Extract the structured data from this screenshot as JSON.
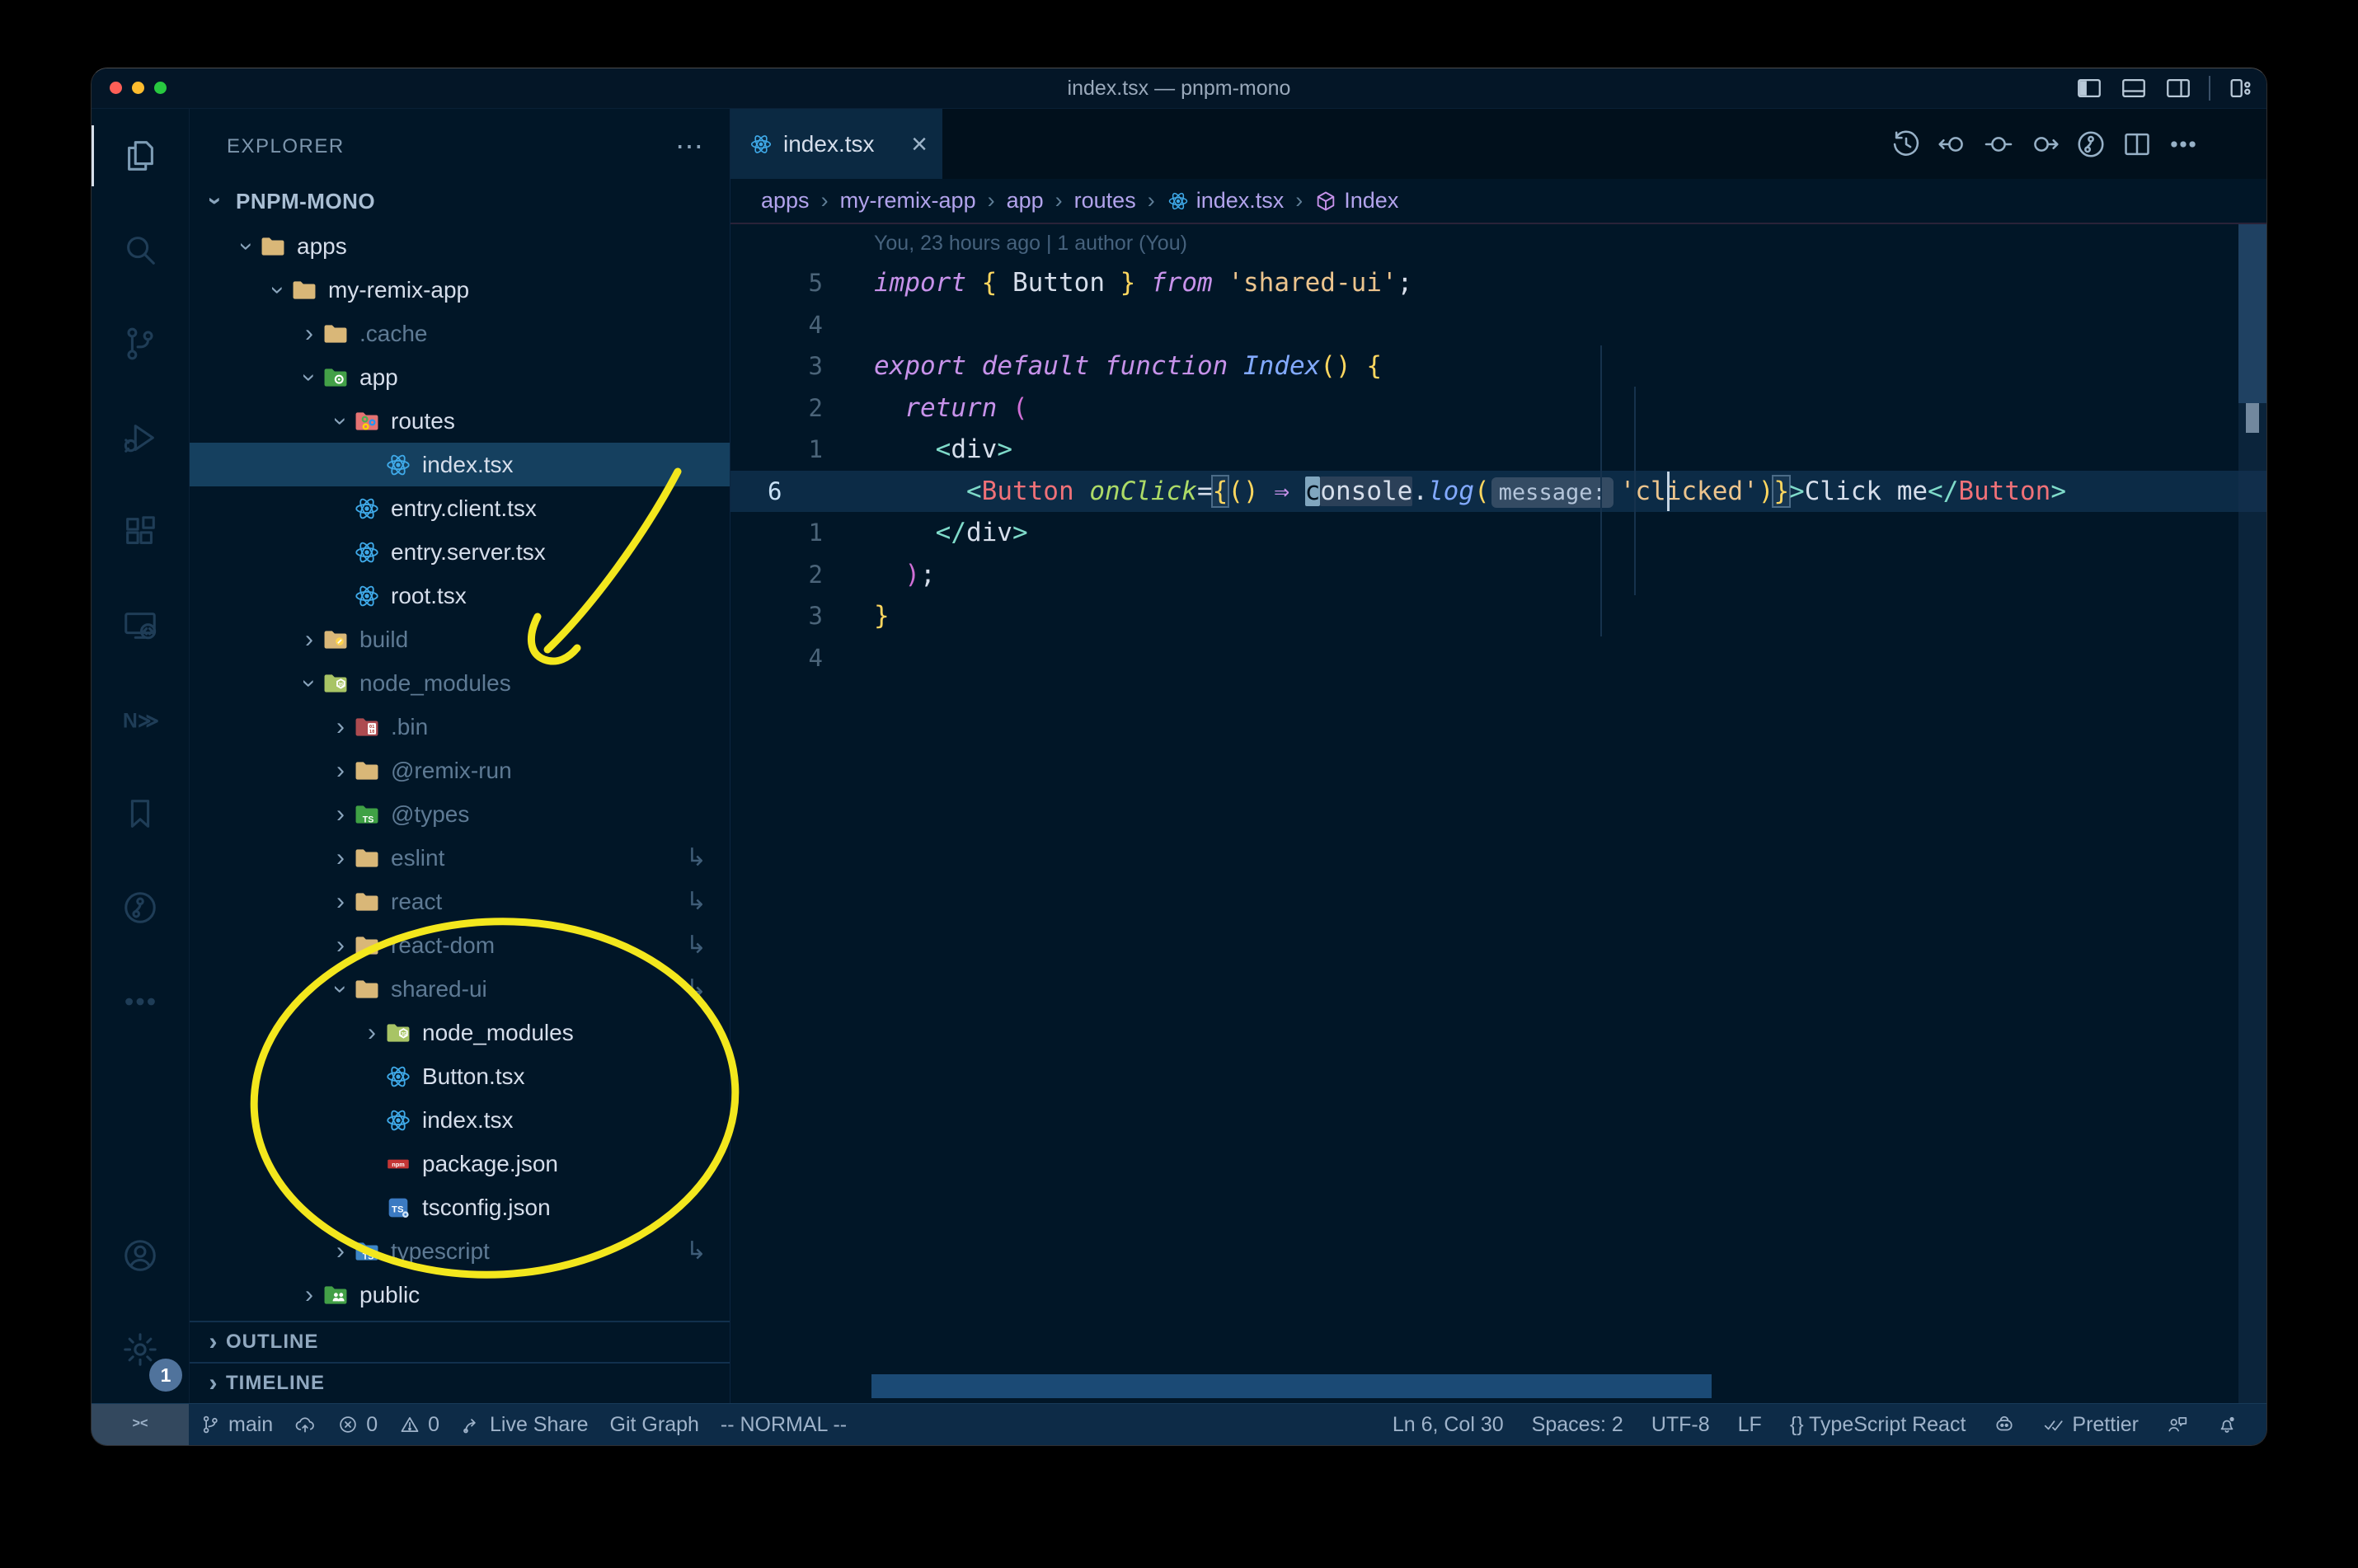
{
  "theme": {
    "background": "#011627",
    "annotation_yellow": "#f3e71d",
    "selection_blue": "#15405f",
    "status_bar": "#0d2b47",
    "active_tab": "#0b2942",
    "react_blue": "#3fa9e8",
    "folder_tan": "#d9b778",
    "traffic_red": "#ff5f57",
    "traffic_yellow": "#febc2e",
    "traffic_green": "#28c840"
  },
  "titlebar": {
    "title": "index.tsx — pnpm-mono",
    "layout_icons": [
      "layout-sidebar-left",
      "layout-panel",
      "layout-sidebar-right",
      "layout-customize"
    ]
  },
  "activity_bar": {
    "items": [
      {
        "name": "explorer",
        "icon": "files",
        "active": true
      },
      {
        "name": "search",
        "icon": "search"
      },
      {
        "name": "source-control",
        "icon": "source-control"
      },
      {
        "name": "run-debug",
        "icon": "debug"
      },
      {
        "name": "extensions",
        "icon": "extensions"
      },
      {
        "name": "remote-explorer",
        "icon": "remote"
      },
      {
        "name": "nx-console",
        "icon": "nx"
      },
      {
        "name": "bookmarks",
        "icon": "bookmark"
      },
      {
        "name": "gitlens",
        "icon": "gitlens"
      },
      {
        "name": "more-views",
        "icon": "more"
      }
    ],
    "bottom": [
      {
        "name": "accounts",
        "icon": "account"
      },
      {
        "name": "settings",
        "icon": "gear",
        "badge": "1"
      }
    ]
  },
  "explorer": {
    "header": "EXPLORER",
    "actions": "⋯",
    "root": "PNPM-MONO",
    "tree": [
      {
        "label": "apps",
        "icon": "folder",
        "level": 0,
        "state": "open"
      },
      {
        "label": "my-remix-app",
        "icon": "folder",
        "level": 1,
        "state": "open"
      },
      {
        "label": ".cache",
        "icon": "folder",
        "level": 2,
        "state": "closed",
        "dim": true
      },
      {
        "label": "app",
        "icon": "folder-app",
        "level": 2,
        "state": "open"
      },
      {
        "label": "routes",
        "icon": "folder-routes",
        "level": 3,
        "state": "open"
      },
      {
        "label": "index.tsx",
        "icon": "react",
        "level": 4,
        "selected": true
      },
      {
        "label": "entry.client.tsx",
        "icon": "react",
        "level": 3
      },
      {
        "label": "entry.server.tsx",
        "icon": "react",
        "level": 3
      },
      {
        "label": "root.tsx",
        "icon": "react",
        "level": 3
      },
      {
        "label": "build",
        "icon": "folder-build",
        "level": 2,
        "state": "closed",
        "dim": true
      },
      {
        "label": "node_modules",
        "icon": "folder-node",
        "level": 2,
        "state": "open",
        "dim": true
      },
      {
        "label": ".bin",
        "icon": "folder-bin",
        "level": 3,
        "state": "closed",
        "dim": true
      },
      {
        "label": "@remix-run",
        "icon": "folder",
        "level": 3,
        "state": "closed",
        "dim": true
      },
      {
        "label": "@types",
        "icon": "folder-types",
        "level": 3,
        "state": "closed",
        "dim": true
      },
      {
        "label": "eslint",
        "icon": "folder",
        "level": 3,
        "state": "closed",
        "dim": true,
        "symlink": true
      },
      {
        "label": "react",
        "icon": "folder",
        "level": 3,
        "state": "closed",
        "dim": true,
        "symlink": true
      },
      {
        "label": "react-dom",
        "icon": "folder",
        "level": 3,
        "state": "closed",
        "dim": true,
        "symlink": true
      },
      {
        "label": "shared-ui",
        "icon": "folder",
        "level": 3,
        "state": "open",
        "dim": true,
        "symlink": true
      },
      {
        "label": "node_modules",
        "icon": "folder-node",
        "level": 4,
        "state": "closed"
      },
      {
        "label": "Button.tsx",
        "icon": "react",
        "level": 4
      },
      {
        "label": "index.tsx",
        "icon": "react",
        "level": 4
      },
      {
        "label": "package.json",
        "icon": "npm",
        "level": 4
      },
      {
        "label": "tsconfig.json",
        "icon": "tsconfig",
        "level": 4
      },
      {
        "label": "typescript",
        "icon": "folder-ts",
        "level": 3,
        "state": "closed",
        "dim": true,
        "symlink": true
      },
      {
        "label": "public",
        "icon": "folder-public",
        "level": 2,
        "state": "closed"
      }
    ],
    "sections": [
      {
        "label": "OUTLINE"
      },
      {
        "label": "TIMELINE"
      }
    ]
  },
  "editor": {
    "tab": {
      "label": "index.tsx",
      "icon": "react",
      "close": "×"
    },
    "toolbar": [
      {
        "name": "timeline",
        "icon": "history"
      },
      {
        "name": "previous-change",
        "icon": "prev-change"
      },
      {
        "name": "open-changes",
        "icon": "open-change"
      },
      {
        "name": "next-change",
        "icon": "next-change"
      },
      {
        "name": "gitlens-file-history",
        "icon": "gitlens"
      },
      {
        "name": "split-editor",
        "icon": "split"
      },
      {
        "name": "more-actions",
        "icon": "more"
      }
    ],
    "breadcrumbs": [
      {
        "label": "apps"
      },
      {
        "label": "my-remix-app"
      },
      {
        "label": "app"
      },
      {
        "label": "routes"
      },
      {
        "label": "index.tsx",
        "icon": "react"
      },
      {
        "label": "Index",
        "icon": "symbol-cube"
      }
    ],
    "blame": "You, 23 hours ago | 1 author (You)",
    "lines": [
      {
        "gutter": "",
        "blame": true
      },
      {
        "gutter": "5",
        "tokens": [
          [
            "import",
            "kw"
          ],
          [
            " ",
            "pl"
          ],
          [
            "{",
            "gold"
          ],
          [
            " ",
            "pl"
          ],
          [
            "Button",
            "pl"
          ],
          [
            " ",
            "pl"
          ],
          [
            "}",
            "gold"
          ],
          [
            " ",
            "pl"
          ],
          [
            "from",
            "kw"
          ],
          [
            " ",
            "pl"
          ],
          [
            "'shared-ui'",
            "str"
          ],
          [
            ";",
            "pl"
          ]
        ]
      },
      {
        "gutter": "4",
        "tokens": []
      },
      {
        "gutter": "3",
        "tokens": [
          [
            "export",
            "kw"
          ],
          [
            " ",
            "pl"
          ],
          [
            "default",
            "kw"
          ],
          [
            " ",
            "pl"
          ],
          [
            "function",
            "kw"
          ],
          [
            " ",
            "pl"
          ],
          [
            "Index",
            "fn"
          ],
          [
            "(",
            "gold"
          ],
          [
            ")",
            "gold"
          ],
          [
            " ",
            "pl"
          ],
          [
            "{",
            "gold"
          ]
        ]
      },
      {
        "gutter": "2",
        "tokens": [
          [
            "  ",
            "pl"
          ],
          [
            "return",
            "kw"
          ],
          [
            " ",
            "pl"
          ],
          [
            "(",
            "mag"
          ]
        ]
      },
      {
        "gutter": "1",
        "tokens": [
          [
            "    ",
            "pl"
          ],
          [
            "<",
            "tag"
          ],
          [
            "div",
            "pl"
          ],
          [
            ">",
            "tag"
          ]
        ]
      },
      {
        "gutter": "6",
        "current": true,
        "tokens": [
          [
            "      ",
            "pl"
          ],
          [
            "<",
            "tag"
          ],
          [
            "Button",
            "comp"
          ],
          [
            " ",
            "pl"
          ],
          [
            "onClick",
            "attr"
          ],
          [
            "=",
            "pl"
          ],
          [
            "{",
            "goldm"
          ],
          [
            "(",
            "gold"
          ],
          [
            ")",
            "gold"
          ],
          [
            " ",
            "pl"
          ],
          [
            "⇒",
            "kw"
          ],
          [
            " ",
            "pl"
          ],
          [
            "c",
            "cursor"
          ],
          [
            "onsole",
            "hl"
          ],
          [
            ".",
            "pl"
          ],
          [
            "log",
            "fn"
          ],
          [
            "(",
            "gold"
          ],
          [
            "message:",
            "inlay"
          ],
          [
            "'clicked'",
            "str"
          ],
          [
            ")",
            "gold"
          ],
          [
            "}",
            "goldm"
          ],
          [
            ">",
            "tag"
          ],
          [
            "Click me",
            "pl"
          ],
          [
            "</",
            "tag"
          ],
          [
            "Button",
            "comp"
          ],
          [
            ">",
            "tag"
          ]
        ]
      },
      {
        "gutter": "1",
        "tokens": [
          [
            "    ",
            "pl"
          ],
          [
            "</",
            "tag"
          ],
          [
            "div",
            "pl"
          ],
          [
            ">",
            "tag"
          ]
        ]
      },
      {
        "gutter": "2",
        "tokens": [
          [
            "  ",
            "pl"
          ],
          [
            ")",
            "mag"
          ],
          [
            ";",
            "pl"
          ]
        ]
      },
      {
        "gutter": "3",
        "tokens": [
          [
            "}",
            "gold"
          ]
        ]
      },
      {
        "gutter": "4",
        "tokens": []
      }
    ]
  },
  "status_bar": {
    "left": [
      {
        "name": "remote-indicator",
        "icon": "remote-text",
        "label": ""
      },
      {
        "name": "git-branch",
        "icon": "branch",
        "label": "main"
      },
      {
        "name": "sync",
        "icon": "cloud-up",
        "label": ""
      },
      {
        "name": "errors",
        "icon": "error",
        "label": "0"
      },
      {
        "name": "warnings",
        "icon": "warning",
        "label": "0"
      },
      {
        "name": "live-share",
        "icon": "liveshare",
        "label": "Live Share"
      },
      {
        "name": "git-graph",
        "label": "Git Graph"
      },
      {
        "name": "vim-mode",
        "label": "-- NORMAL --"
      }
    ],
    "right": [
      {
        "name": "cursor-position",
        "label": "Ln 6, Col 30"
      },
      {
        "name": "indentation",
        "label": "Spaces: 2"
      },
      {
        "name": "encoding",
        "label": "UTF-8"
      },
      {
        "name": "eol",
        "label": "LF"
      },
      {
        "name": "language-mode",
        "label": "{} TypeScript React"
      },
      {
        "name": "copilot",
        "icon": "copilot",
        "label": ""
      },
      {
        "name": "formatter",
        "icon": "check2",
        "label": "Prettier"
      },
      {
        "name": "feedback",
        "icon": "feedback",
        "label": ""
      },
      {
        "name": "notifications",
        "icon": "bell",
        "label": ""
      }
    ]
  },
  "annotations": {
    "color": "#f3e71d",
    "arrow_target": "node_modules",
    "ellipse_target": "shared-ui package contents"
  }
}
